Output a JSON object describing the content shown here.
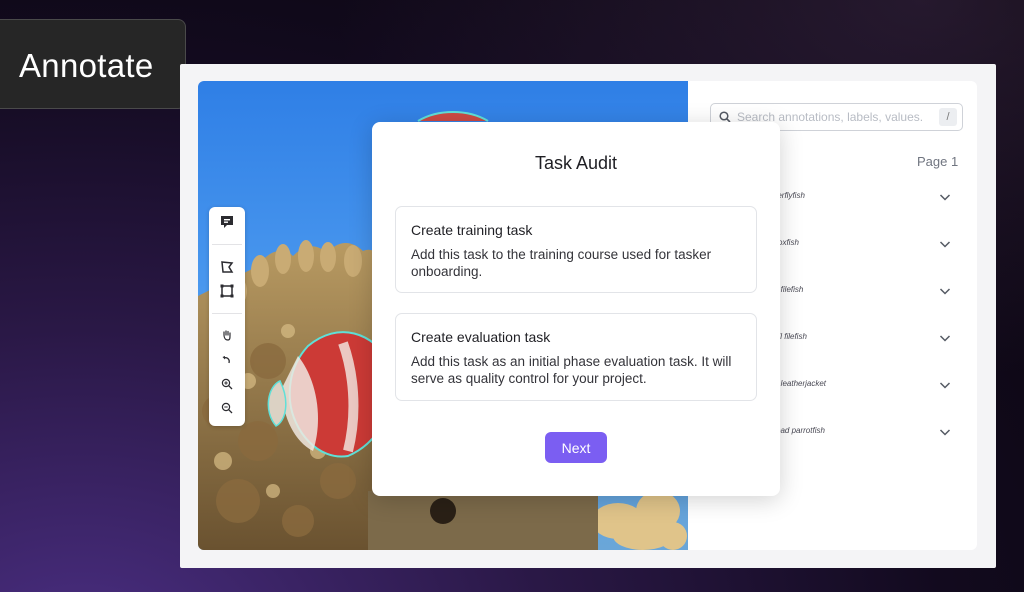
{
  "overlay": {
    "tag_label": "Annotate"
  },
  "sidebar": {
    "search": {
      "placeholder": "Search annotations, labels, values.",
      "shortcut": "/"
    },
    "page_label": "Page 1",
    "annotations": [
      {
        "label": "butterflyfish"
      },
      {
        "label": "oxfish"
      },
      {
        "label": "d filefish"
      },
      {
        "label": "ail filefish"
      },
      {
        "label": "d leatherjacket"
      },
      {
        "label": "ead parrotfish"
      }
    ]
  },
  "toolbar": {
    "tools": [
      "comment-icon",
      "polygon-tool-icon",
      "bounding-box-icon",
      "pan-hand-icon",
      "undo-icon",
      "zoom-in-icon",
      "zoom-out-icon"
    ]
  },
  "modal": {
    "title": "Task Audit",
    "options": [
      {
        "title": "Create training task",
        "description": "Add this task to the training course used for tasker onboarding."
      },
      {
        "title": "Create evaluation task",
        "description": "Add this task as an initial phase evaluation task. It will serve as quality control for your project."
      }
    ],
    "next_label": "Next"
  },
  "colors": {
    "accent": "#7b5ef2",
    "frame": "#f4f4f6",
    "annotation_outline": "#5fe0d8"
  }
}
